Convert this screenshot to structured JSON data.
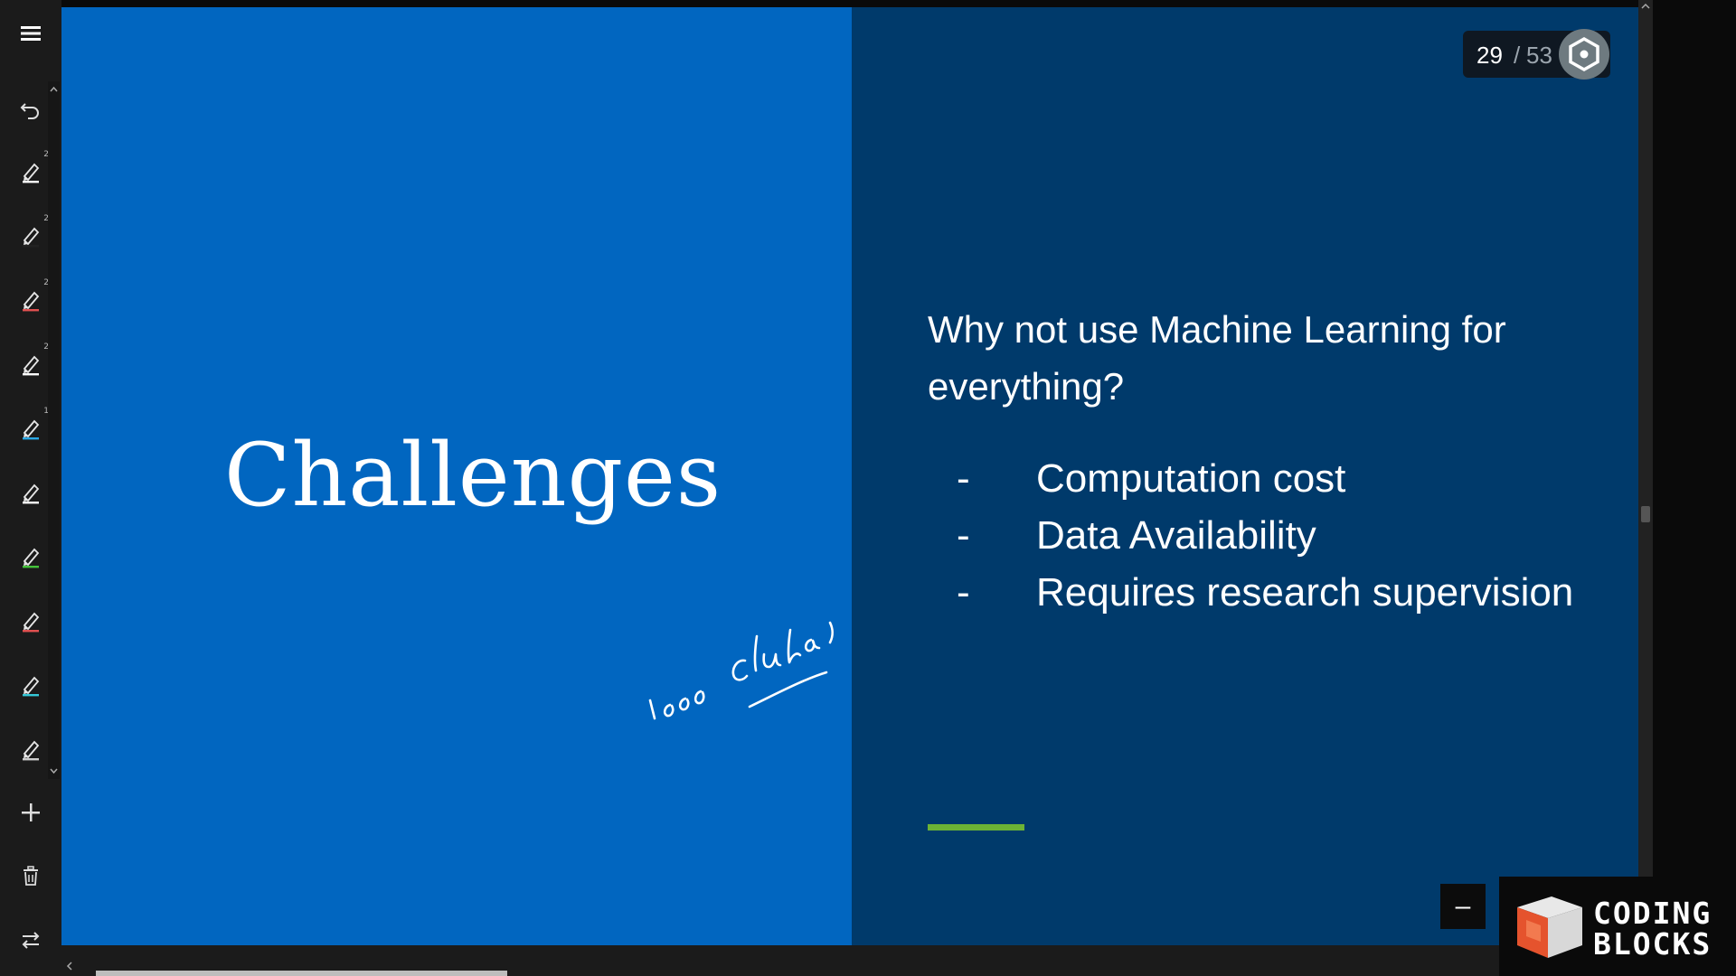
{
  "toolbar": {
    "items": [
      {
        "icon": "menu-icon"
      },
      {
        "icon": "undo-icon"
      },
      {
        "icon": "pen-icon",
        "badge": "2",
        "color": "#ffffff"
      },
      {
        "icon": "pen-icon",
        "badge": "2",
        "color": "#222222"
      },
      {
        "icon": "pen-icon",
        "badge": "2",
        "color": "#e05050"
      },
      {
        "icon": "pen-icon",
        "badge": "2",
        "color": "#ffffff"
      },
      {
        "icon": "pen-icon",
        "badge": "1",
        "color": "#2aa8e6"
      },
      {
        "icon": "pen-icon",
        "color": "#ffffff"
      },
      {
        "icon": "pen-icon",
        "color": "#44c23a"
      },
      {
        "icon": "pen-icon",
        "color": "#e05050"
      },
      {
        "icon": "pen-icon",
        "color": "#35c8d8"
      },
      {
        "icon": "pen-icon",
        "color": "#cccccc"
      },
      {
        "icon": "plus-icon"
      },
      {
        "icon": "trash-icon"
      },
      {
        "icon": "swap-icon"
      }
    ]
  },
  "slide": {
    "title": "Challenges",
    "question": "Why not use Machine Learning for everything?",
    "bullets": [
      {
        "dash": "-",
        "text": "Computation cost"
      },
      {
        "dash": "-",
        "text": "Data Availability"
      },
      {
        "dash": "-",
        "text": "Requires research supervision"
      }
    ],
    "colors": {
      "left": "#0166c0",
      "right": "#003a6b",
      "accent": "#6cb335"
    },
    "handwritten_note": "1000 clusters"
  },
  "pager": {
    "current": "29",
    "separator": "/",
    "total": "53",
    "icon": "settings-hex-icon"
  },
  "controls": {
    "minus_label": "–"
  },
  "logo": {
    "line1": "CODING",
    "line2": "BLOCKS",
    "icon": "cube-logo-icon"
  }
}
